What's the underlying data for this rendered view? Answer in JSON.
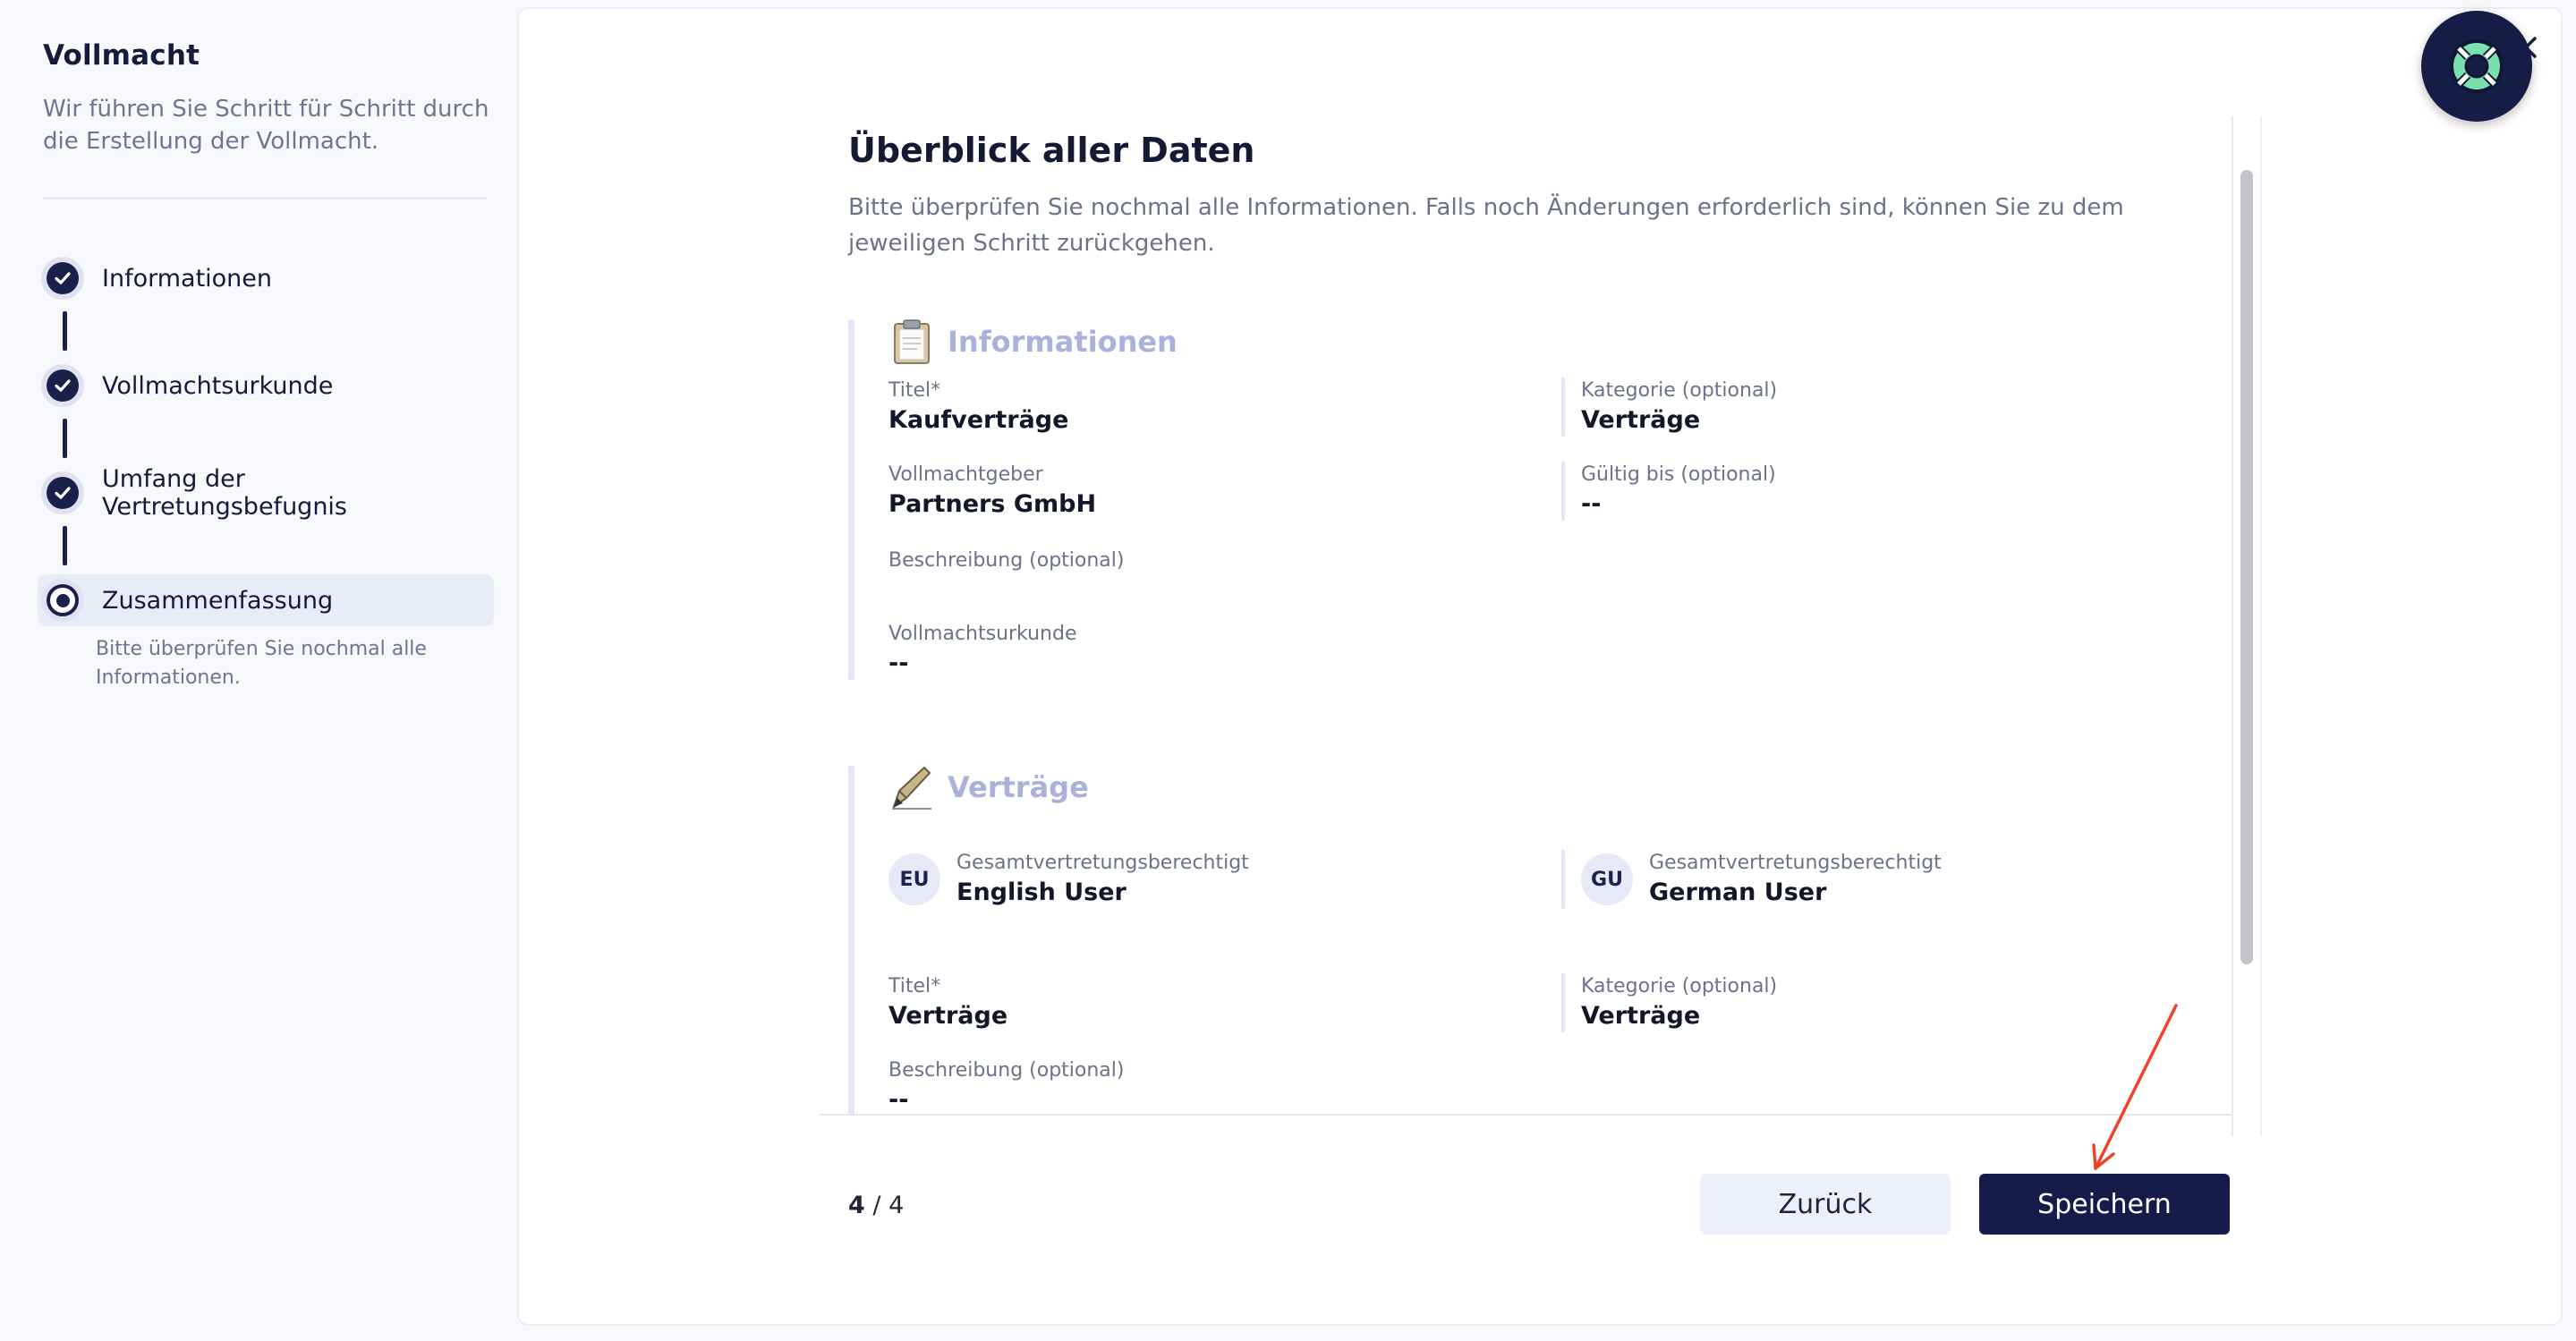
{
  "colors": {
    "primary": "#151c4a",
    "accent_light": "#aab2dc",
    "muted_text": "#6b7289",
    "annotation": "#e8452c"
  },
  "sidebar": {
    "title": "Vollmacht",
    "subtitle": "Wir führen Sie Schritt für Schritt durch die Erstellung der Vollmacht.",
    "steps": [
      {
        "label": "Informationen",
        "status": "completed",
        "icon": "check-icon"
      },
      {
        "label": "Vollmachtsurkunde",
        "status": "completed",
        "icon": "check-icon"
      },
      {
        "label": "Umfang der Vertretungsbefugnis",
        "status": "completed",
        "icon": "check-icon"
      },
      {
        "label": "Zusammenfassung",
        "status": "current",
        "icon": "radio-dot-icon"
      }
    ],
    "current_step_description": "Bitte überprüfen Sie nochmal alle Informationen."
  },
  "help_button_icon": "lifebuoy-icon",
  "overview": {
    "title": "Überblick aller Daten",
    "subtitle": "Bitte überprüfen Sie nochmal alle Informationen. Falls noch Änderungen erforderlich sind, können Sie zu dem jeweiligen Schritt zurückgehen."
  },
  "section_info": {
    "icon": "clipboard-icon",
    "title": "Informationen",
    "titel_label": "Titel*",
    "titel_value": "Kaufverträge",
    "kategorie_label": "Kategorie (optional)",
    "kategorie_value": "Verträge",
    "vollmachtgeber_label": "Vollmachtgeber",
    "vollmachtgeber_value": "Partners GmbH",
    "gueltig_label": "Gültig bis (optional)",
    "gueltig_value": "--",
    "beschreibung_label": "Beschreibung (optional)",
    "urkunde_label": "Vollmachtsurkunde",
    "urkunde_value": "--"
  },
  "section_contracts": {
    "icon": "pen-icon",
    "title": "Verträge",
    "users": [
      {
        "initials": "EU",
        "role": "Gesamtvertretungsberechtigt",
        "name": "English User"
      },
      {
        "initials": "GU",
        "role": "Gesamtvertretungsberechtigt",
        "name": "German User"
      }
    ],
    "titel_label": "Titel*",
    "titel_value": "Verträge",
    "kategorie_label": "Kategorie (optional)",
    "kategorie_value": "Verträge",
    "beschreibung_label": "Beschreibung (optional)",
    "beschreibung_value": "--"
  },
  "footer": {
    "page_current": "4",
    "page_separator": "/",
    "page_total": "4",
    "back_label": "Zurück",
    "save_label": "Speichern"
  }
}
